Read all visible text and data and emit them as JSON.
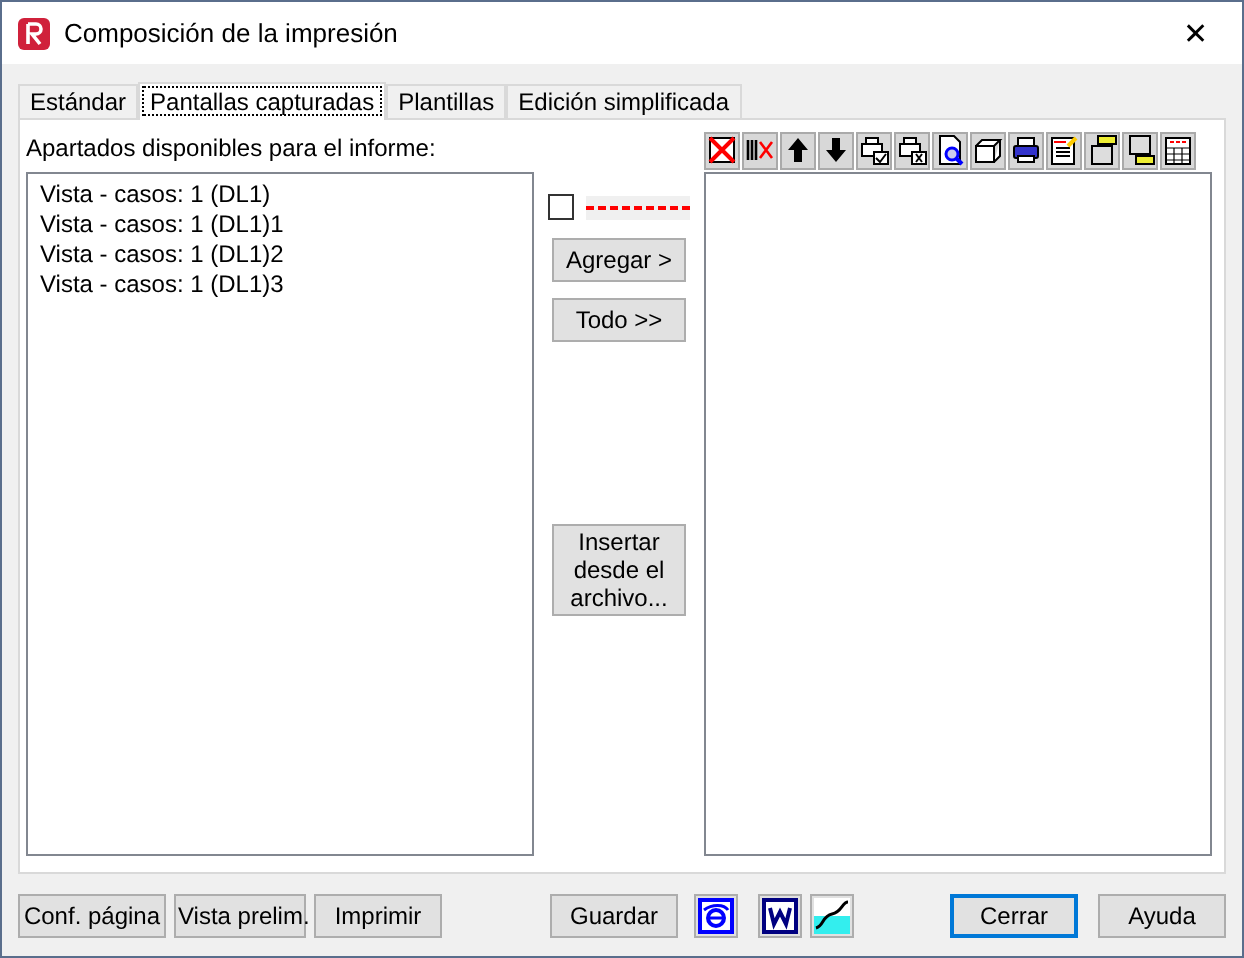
{
  "window": {
    "title": "Composición de la impresión",
    "close": "✕"
  },
  "tabs": [
    {
      "label": "Estándar",
      "selected": false
    },
    {
      "label": "Pantallas capturadas",
      "selected": true
    },
    {
      "label": "Plantillas",
      "selected": false
    },
    {
      "label": "Edición simplificada",
      "selected": false
    }
  ],
  "available": {
    "label": "Apartados disponibles para el informe:",
    "items": [
      "Vista - casos: 1 (DL1)",
      "Vista - casos: 1 (DL1)1",
      "Vista - casos: 1 (DL1)2",
      "Vista - casos: 1 (DL1)3"
    ]
  },
  "separator_option": {
    "checked": false
  },
  "middle_buttons": [
    "Agregar >",
    "Todo >>",
    "Insertar desde el archivo..."
  ],
  "bottom_left_buttons": [
    "Conf. página",
    "Vista prelim.",
    "Imprimir"
  ],
  "save_button": "Guardar",
  "bottom_right_buttons": [
    {
      "label": "Cerrar",
      "selected": true
    },
    {
      "label": "Ayuda",
      "selected": false
    }
  ]
}
